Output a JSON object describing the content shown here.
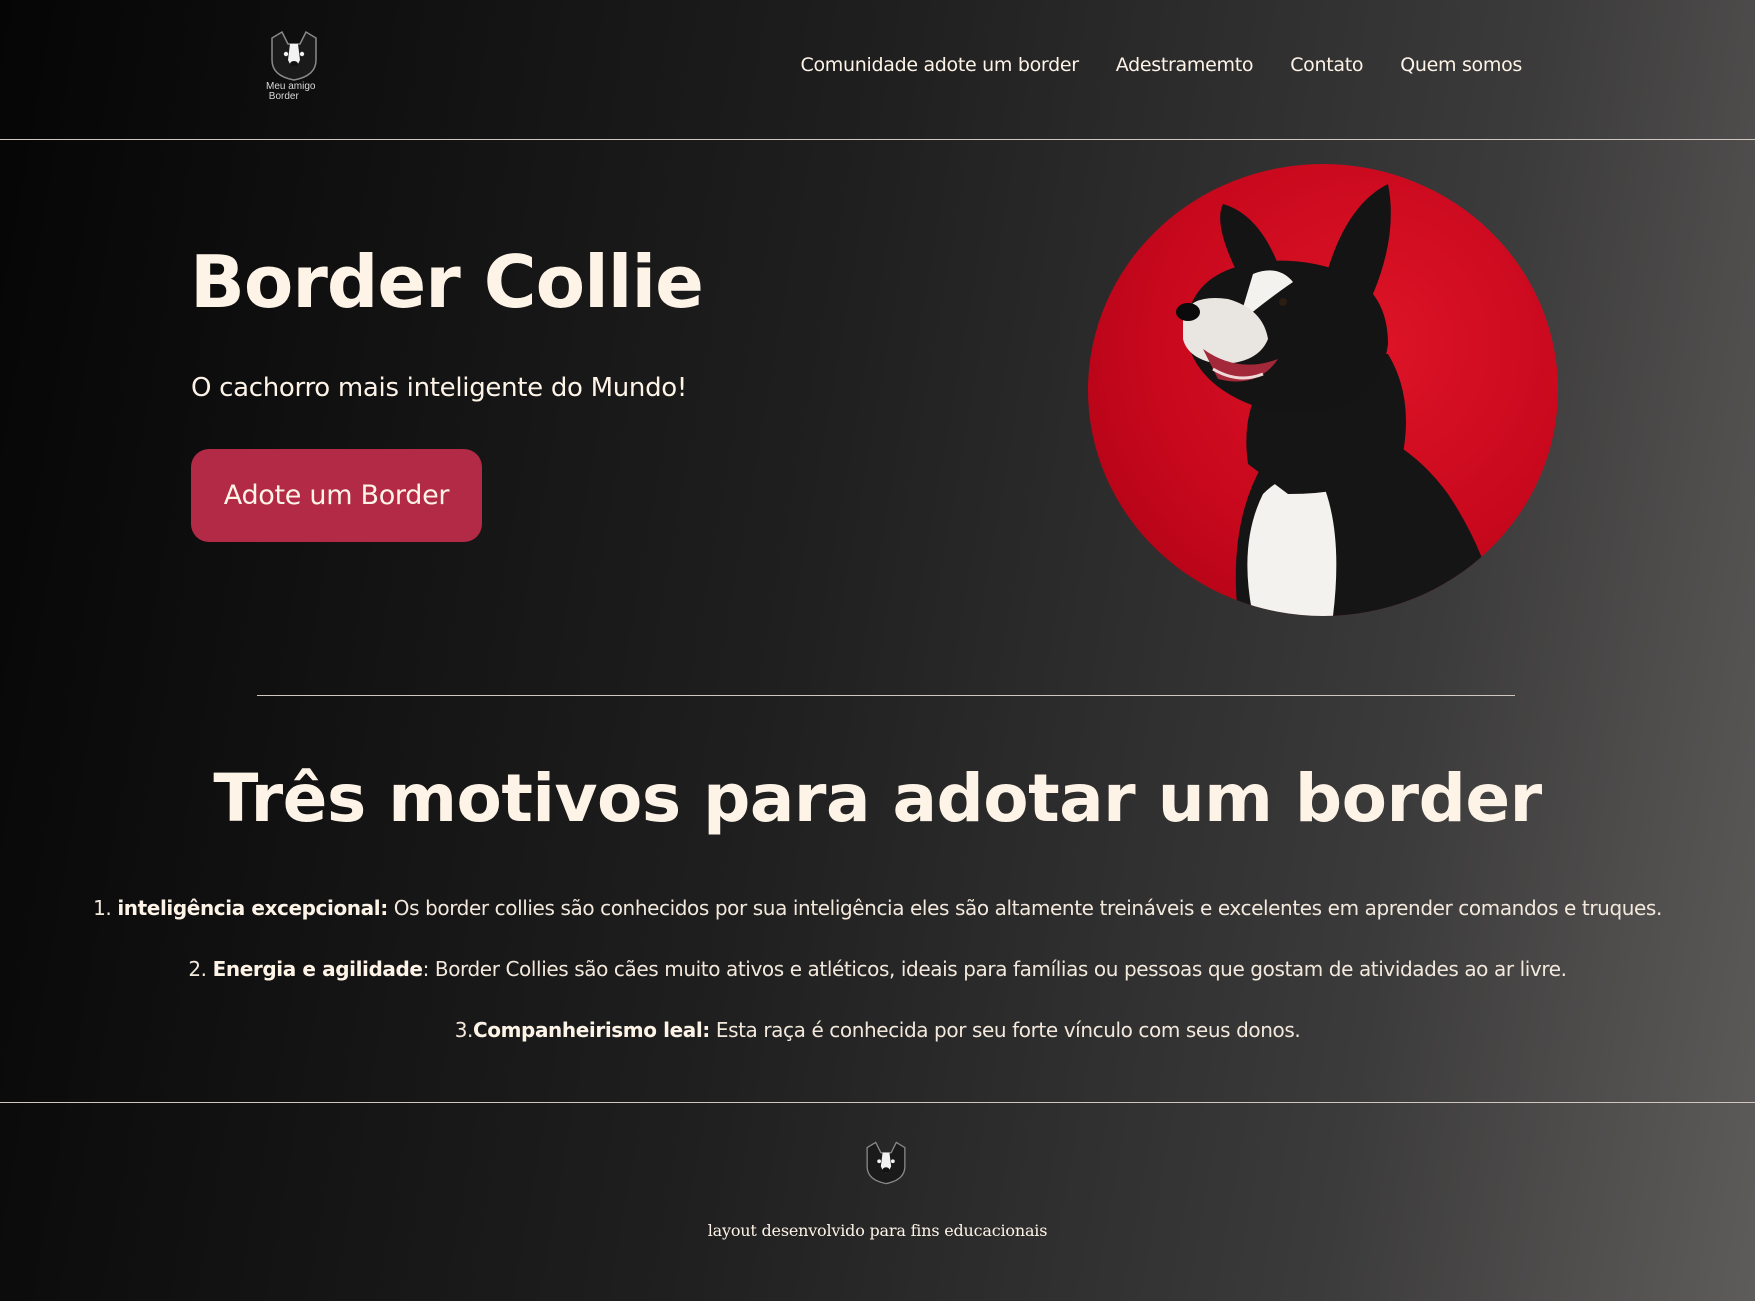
{
  "header": {
    "logo_text_line1": "Meu amigo",
    "logo_text_line2": "Border",
    "nav": [
      {
        "label": "Comunidade adote um border"
      },
      {
        "label": "Adestramemto"
      },
      {
        "label": "Contato"
      },
      {
        "label": "Quem somos"
      }
    ]
  },
  "hero": {
    "title": "Border Collie",
    "subtitle": "O cachorro mais inteligente do Mundo!",
    "cta_label": "Adote um Border",
    "image_icon": "border-collie-photo",
    "image_bg_color": "#c8081d"
  },
  "reasons": {
    "title": "Três motivos para adotar um border",
    "items": [
      {
        "prefix": "1. ",
        "bold": "inteligência excepcional:",
        "text": " Os border collies são conhecidos por sua inteligência eles são altamente treináveis e excelentes em aprender comandos e truques."
      },
      {
        "prefix": "2. ",
        "bold": "Energia e agilidade",
        "text": ": Border Collies são cães muito ativos e atléticos, ideais para famílias ou pessoas que gostam de atividades ao ar livre."
      },
      {
        "prefix": "3.",
        "bold": "Companheirismo leal:",
        "text": " Esta raça é conhecida por seu forte vínculo com seus donos."
      }
    ]
  },
  "footer": {
    "text": "layout desenvolvido para fins educacionais"
  },
  "colors": {
    "accent": "#b22a45",
    "text": "#fdf3e7",
    "divider": "#cfc7c0"
  }
}
